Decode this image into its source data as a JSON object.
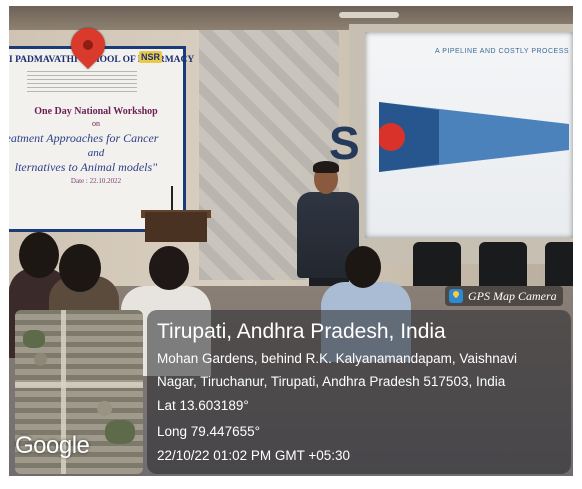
{
  "banner": {
    "school": "I PADMAVATHI SCHOOL OF PHARMACY",
    "logo": "NSR",
    "line1": "One Day National Workshop",
    "line2": "on",
    "line3": "eatment Approaches for Cancer",
    "line4": "and",
    "line5": "lternatives to Animal models\"",
    "line6": "Date : 22.10.2022"
  },
  "projection": {
    "title": "A PIPELINE AND COSTLY PROCESS"
  },
  "gps": {
    "app_name": "GPS Map Camera",
    "city": "Tirupati, Andhra Pradesh, India",
    "address_line1": "Mohan Gardens, behind R.K. Kalyanamandapam, Vaishnavi",
    "address_line2": "Nagar, Tiruchanur, Tirupati, Andhra Pradesh 517503, India",
    "lat": "Lat 13.603189°",
    "long": "Long 79.447655°",
    "datetime": "22/10/22 01:02 PM GMT +05:30"
  },
  "map": {
    "logo": "Google",
    "pin_color": "#d93a2b"
  },
  "colors": {
    "banner_border": "#1a3a78",
    "banner_text": "#1b2f74"
  }
}
